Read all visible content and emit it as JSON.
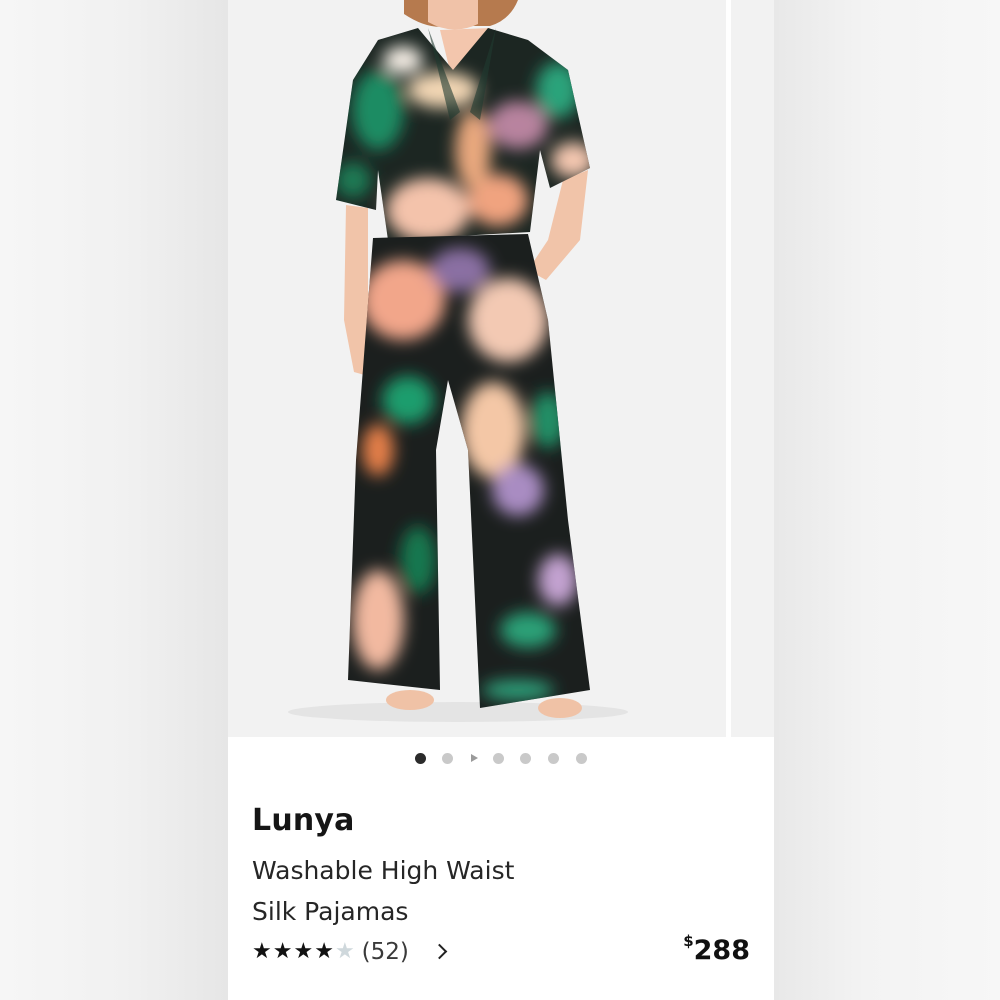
{
  "carousel": {
    "image_count": 7,
    "active_index": 0
  },
  "product": {
    "brand": "Lunya",
    "name_line1": "Washable High Waist",
    "name_line2": "Silk Pajamas",
    "rating": 4,
    "rating_max": 5,
    "review_count": "(52)",
    "price_symbol": "$",
    "price_amount": "288"
  },
  "icons": {
    "star_full": "star-icon",
    "star_empty": "star-outline-icon",
    "chevron": "chevron-right-icon",
    "video": "play-icon"
  },
  "colors": {
    "page_bg": "#ececec",
    "card_bg": "#ffffff",
    "text": "#151515",
    "star_empty": "#cfd8dc"
  }
}
